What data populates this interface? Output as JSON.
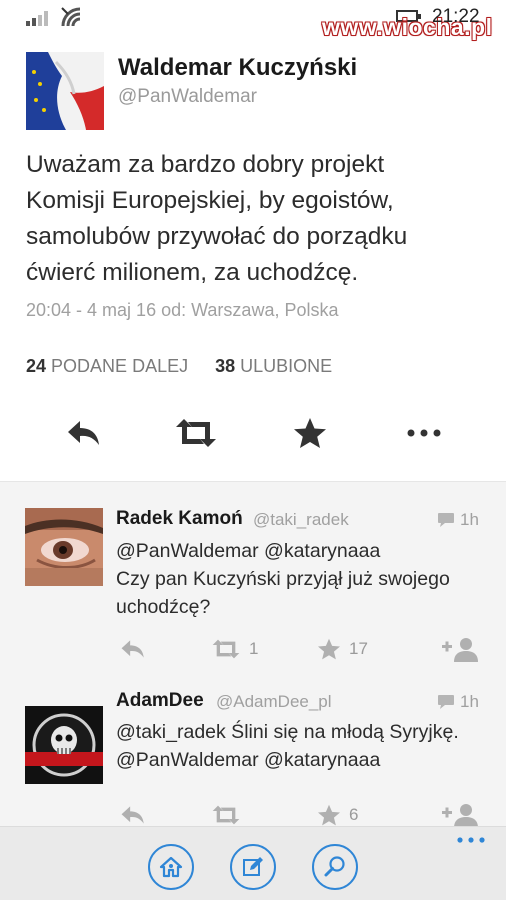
{
  "status_bar": {
    "time": "21:22",
    "watermark": "www.wiocha.pl"
  },
  "tweet": {
    "author_name": "Waldemar Kuczyński",
    "author_handle": "@PanWaldemar",
    "lines": [
      "Uważam za bardzo dobry projekt",
      "Komisji Europejskiej, by egoistów,",
      "samolubów przywołać do porządku",
      "ćwierć milionem, za uchodźcę."
    ],
    "meta": "20:04 - 4 maj 16 od: Warszawa, Polska",
    "retweets_count": "24",
    "retweets_label": "PODANE DALEJ",
    "likes_count": "38",
    "likes_label": "ULUBIONE"
  },
  "replies": [
    {
      "name": "Radek Kamoń",
      "handle": "@taki_radek",
      "time": "1h",
      "lines": [
        "@PanWaldemar @katarynaaa",
        "Czy pan Kuczyński przyjął już swojego",
        "uchodźcę?"
      ],
      "retweets": "1",
      "likes": "17"
    },
    {
      "name": "AdamDee",
      "handle": "@AdamDee_pl",
      "time": "1h",
      "lines": [
        "@taki_radek Ślini się na młodą Syryjkę.",
        "@PanWaldemar @katarynaaa"
      ],
      "retweets": "",
      "likes": "6"
    }
  ],
  "icons": {
    "reply": "reply-icon",
    "retweet": "retweet-icon",
    "like": "star-icon",
    "more": "more-icon",
    "follow": "add-person-icon",
    "home": "home-icon",
    "compose": "compose-icon",
    "search": "search-icon"
  },
  "colors": {
    "accent": "#2f86d6",
    "muted": "#9a9a9a",
    "reply_background": "#f4f4f4"
  }
}
